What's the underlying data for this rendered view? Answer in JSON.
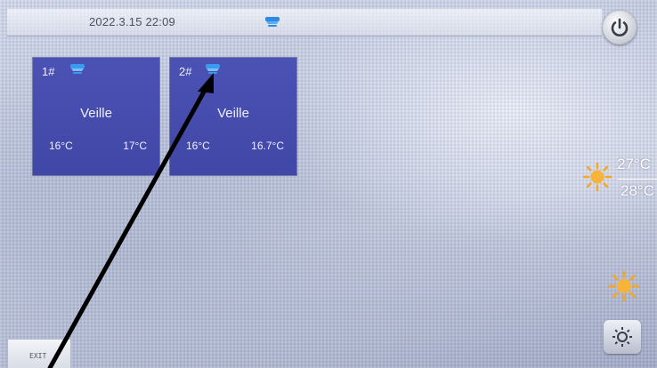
{
  "status_bar": {
    "datetime": "2022.3.15 22:09",
    "mode_icon": "cooling-fan-icon"
  },
  "power_button": {
    "icon": "power-icon"
  },
  "units": [
    {
      "number": "1#",
      "mode_icon": "cooling-fan-icon",
      "status": "Veille",
      "temp_current": "16°C",
      "temp_set": "17°C"
    },
    {
      "number": "2#",
      "mode_icon": "cooling-fan-icon",
      "status": "Veille",
      "temp_current": "16°C",
      "temp_set": "16.7°C"
    }
  ],
  "weather": {
    "icon": "sun-icon",
    "temp_max": "27°C",
    "temp_min": "28°C"
  },
  "secondary_weather": {
    "icon": "sun-icon"
  },
  "settings_button": {
    "icon": "gear-icon"
  },
  "exit_button": {
    "label": "EXIT"
  },
  "colors": {
    "card_bg": "#4a51b2",
    "accent_blue": "#2f8ae0",
    "sun": "#f5a623"
  }
}
